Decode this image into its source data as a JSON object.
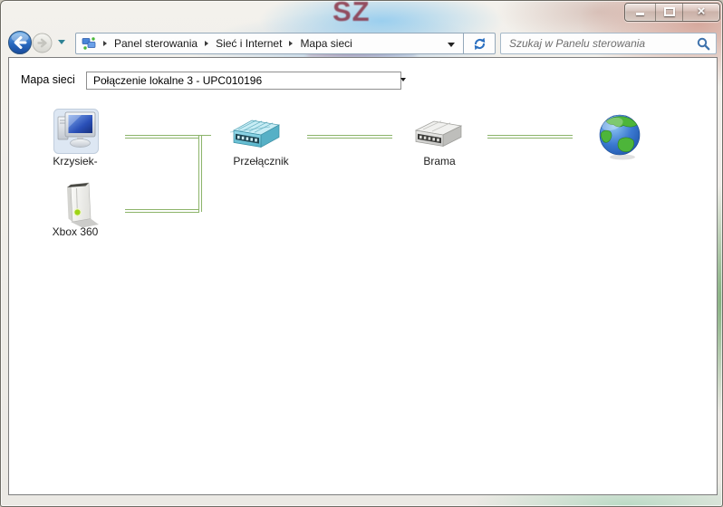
{
  "titlebar": {
    "watermark": "SZ",
    "close_glyph": "×"
  },
  "navbar": {
    "breadcrumb": [
      "Panel sterowania",
      "Sieć i Internet",
      "Mapa sieci"
    ],
    "search_placeholder": "Szukaj w Panelu sterowania"
  },
  "toolbar": {
    "label": "Mapa sieci",
    "connection": "Połączenie lokalne 3 - UPC010196"
  },
  "map": {
    "nodes": [
      {
        "type": "computer",
        "label": "Krzysiek-"
      },
      {
        "type": "xbox",
        "label": "Xbox 360"
      },
      {
        "type": "switch",
        "label": "Przełącznik"
      },
      {
        "type": "gateway",
        "label": "Brama"
      },
      {
        "type": "internet",
        "label": ""
      }
    ],
    "line_color": "#8cb46a"
  },
  "icons": {
    "back": "circle-arrow-left",
    "forward": "circle-arrow-right-disabled",
    "recent-pages": "chevron-down",
    "address-expand": "chevron-down",
    "refresh": "blue-refresh-arrows",
    "search": "magnifier",
    "combo-expand": "chevron-down",
    "minimize": "bar",
    "maximize": "square",
    "close": "x"
  },
  "colors": {
    "connection_line": "#8cb46a",
    "back_button_blue": "#2a6ac0",
    "glass_blue": "#96cdee",
    "glass_pink": "#d2a094"
  }
}
